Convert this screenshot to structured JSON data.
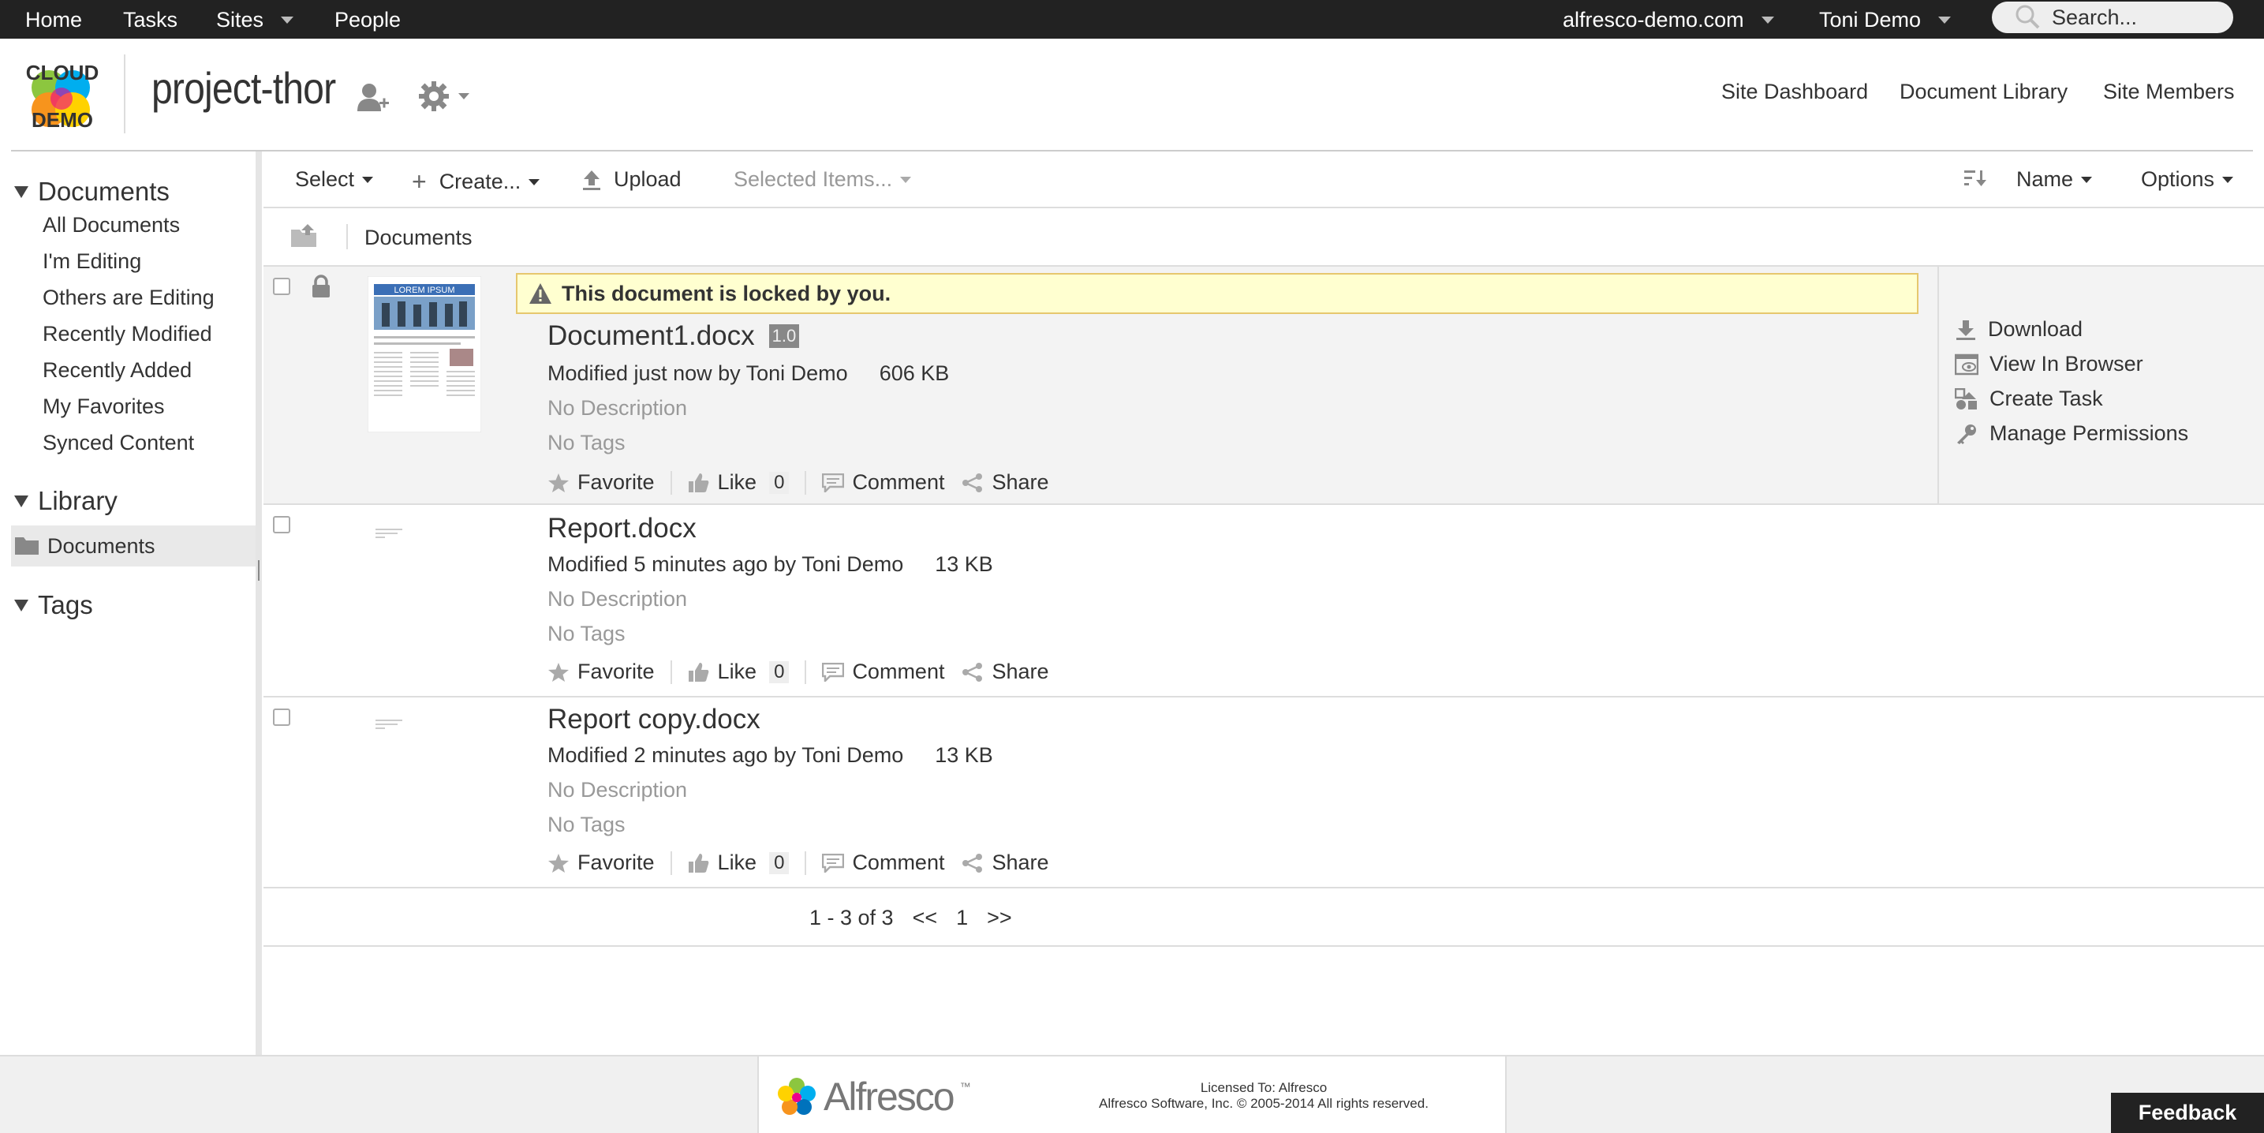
{
  "topbar": {
    "home": "Home",
    "tasks": "Tasks",
    "sites": "Sites",
    "people": "People",
    "network": "alfresco-demo.com",
    "user": "Toni Demo",
    "search_placeholder": "Search..."
  },
  "header": {
    "logo_line1": "CLOUD",
    "logo_line2": "DEMO",
    "site_title": "project-thor",
    "nav": [
      "Site Dashboard",
      "Document Library",
      "Site Members"
    ]
  },
  "sidebar": {
    "documents_header": "Documents",
    "document_filters": [
      "All Documents",
      "I'm Editing",
      "Others are Editing",
      "Recently Modified",
      "Recently Added",
      "My Favorites",
      "Synced Content"
    ],
    "library_header": "Library",
    "library_folder": "Documents",
    "tags_header": "Tags"
  },
  "toolbar": {
    "select": "Select",
    "create": "Create...",
    "upload": "Upload",
    "selected_items": "Selected Items...",
    "sort_field": "Name",
    "options": "Options"
  },
  "breadcrumb": "Documents",
  "documents": [
    {
      "locked_banner": "This document is locked by you.",
      "name": "Document1.docx",
      "version": "1.0",
      "modified": "Modified just now by Toni Demo",
      "size": "606 KB",
      "description": "No Description",
      "tags": "No Tags",
      "thumb_title": "LOREM IPSUM",
      "likes": "0"
    },
    {
      "name": "Report.docx",
      "modified": "Modified 5 minutes ago by Toni Demo",
      "size": "13 KB",
      "description": "No Description",
      "tags": "No Tags",
      "likes": "0"
    },
    {
      "name": "Report copy.docx",
      "modified": "Modified 2 minutes ago by Toni Demo",
      "size": "13 KB",
      "description": "No Description",
      "tags": "No Tags",
      "likes": "0"
    }
  ],
  "doc_actions": {
    "favorite": "Favorite",
    "like": "Like",
    "comment": "Comment",
    "share": "Share"
  },
  "row_actions": [
    "Download",
    "View In Browser",
    "Create Task",
    "Manage Permissions"
  ],
  "pager": {
    "range": "1 - 3 of 3",
    "prev": "<<",
    "page": "1",
    "next": ">>"
  },
  "footer": {
    "brand": "Alfresco",
    "trademark": "™",
    "licensed_to": "Licensed To: Alfresco",
    "copyright": "Alfresco Software, Inc. © 2005-2014 All rights reserved.",
    "feedback": "Feedback"
  },
  "colors": {
    "topbar_bg": "#222222",
    "lock_banner_bg": "#ffffd0",
    "lock_banner_border": "#e6c76e",
    "selected_row_bg": "#f3f3f3",
    "muted_text": "#999999"
  }
}
